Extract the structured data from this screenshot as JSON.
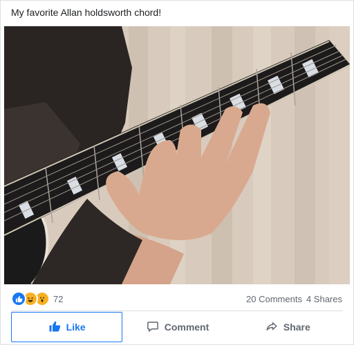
{
  "post": {
    "text": "My favorite Allan holdsworth chord!"
  },
  "photo": {
    "alt": "Hand playing a chord on an electric guitar fretboard"
  },
  "reactions": {
    "types": [
      "like-icon",
      "haha-icon",
      "wow-icon"
    ],
    "count": "72"
  },
  "stats": {
    "comments": "20 Comments",
    "shares": "4 Shares"
  },
  "actions": {
    "like": "Like",
    "comment": "Comment",
    "share": "Share"
  },
  "colors": {
    "brand": "#1877f2",
    "reaction_yellow": "#f7b125",
    "muted_text": "#606770"
  }
}
